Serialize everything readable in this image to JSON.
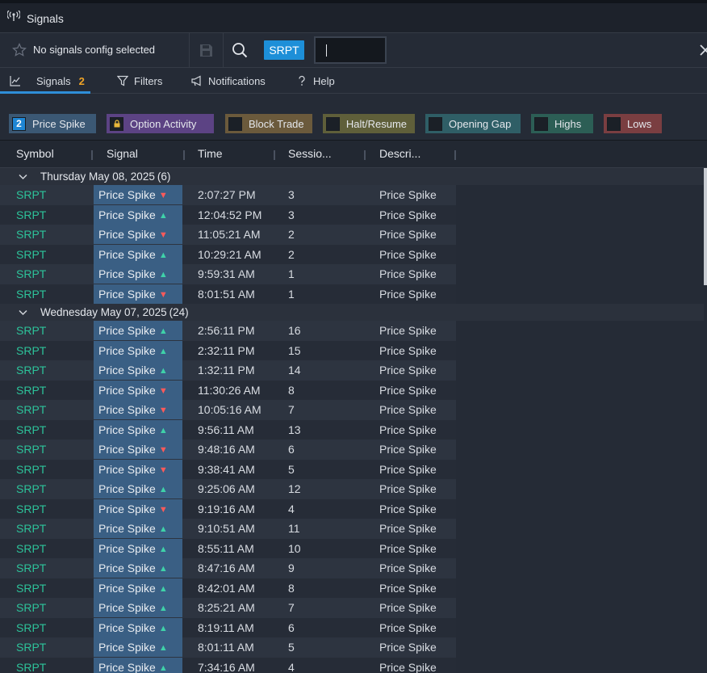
{
  "window": {
    "title": "Signals"
  },
  "toolbar": {
    "config_label": "No signals config selected",
    "symbol": "SRPT",
    "input_value": ""
  },
  "tabs": [
    {
      "label": "Signals",
      "count": "2",
      "icon": "line-chart-icon"
    },
    {
      "label": "Filters",
      "icon": "funnel-icon"
    },
    {
      "label": "Notifications",
      "icon": "megaphone-icon"
    },
    {
      "label": "Help",
      "icon": "question-icon"
    }
  ],
  "chips": [
    {
      "label": "Price Spike",
      "badge": "2",
      "bg": "#3b5874",
      "box": "#1e86d4"
    },
    {
      "label": "Option Activity",
      "badge": "lock",
      "bg": "#5c4384",
      "box": "#1b2027"
    },
    {
      "label": "Block Trade",
      "badge": "",
      "bg": "#6b5a3c",
      "box": "#1b2027"
    },
    {
      "label": "Halt/Resume",
      "badge": "",
      "bg": "#5f5f3a",
      "box": "#1b2027"
    },
    {
      "label": "Opening Gap",
      "badge": "",
      "bg": "#2f5e66",
      "box": "#1b2027"
    },
    {
      "label": "Highs",
      "badge": "",
      "bg": "#2c5e55",
      "box": "#1b2027"
    },
    {
      "label": "Lows",
      "badge": "",
      "bg": "#7a3e41",
      "box": "#1b2027"
    }
  ],
  "columns": [
    "Symbol",
    "Signal",
    "Time",
    "Sessio...",
    "Descri..."
  ],
  "groups": [
    {
      "label": "Thursday May 08, 2025",
      "count": "(6)",
      "rows": [
        {
          "symbol": "SRPT",
          "signal": "Price Spike",
          "dir": "down",
          "time": "2:07:27 PM",
          "session": "3",
          "desc": "Price Spike"
        },
        {
          "symbol": "SRPT",
          "signal": "Price Spike",
          "dir": "up",
          "time": "12:04:52 PM",
          "session": "3",
          "desc": "Price Spike"
        },
        {
          "symbol": "SRPT",
          "signal": "Price Spike",
          "dir": "down",
          "time": "11:05:21 AM",
          "session": "2",
          "desc": "Price Spike"
        },
        {
          "symbol": "SRPT",
          "signal": "Price Spike",
          "dir": "up",
          "time": "10:29:21 AM",
          "session": "2",
          "desc": "Price Spike"
        },
        {
          "symbol": "SRPT",
          "signal": "Price Spike",
          "dir": "up",
          "time": "9:59:31 AM",
          "session": "1",
          "desc": "Price Spike"
        },
        {
          "symbol": "SRPT",
          "signal": "Price Spike",
          "dir": "down",
          "time": "8:01:51 AM",
          "session": "1",
          "desc": "Price Spike"
        }
      ]
    },
    {
      "label": "Wednesday May 07, 2025",
      "count": "(24)",
      "rows": [
        {
          "symbol": "SRPT",
          "signal": "Price Spike",
          "dir": "up",
          "time": "2:56:11 PM",
          "session": "16",
          "desc": "Price Spike"
        },
        {
          "symbol": "SRPT",
          "signal": "Price Spike",
          "dir": "up",
          "time": "2:32:11 PM",
          "session": "15",
          "desc": "Price Spike"
        },
        {
          "symbol": "SRPT",
          "signal": "Price Spike",
          "dir": "up",
          "time": "1:32:11 PM",
          "session": "14",
          "desc": "Price Spike"
        },
        {
          "symbol": "SRPT",
          "signal": "Price Spike",
          "dir": "down",
          "time": "11:30:26 AM",
          "session": "8",
          "desc": "Price Spike"
        },
        {
          "symbol": "SRPT",
          "signal": "Price Spike",
          "dir": "down",
          "time": "10:05:16 AM",
          "session": "7",
          "desc": "Price Spike"
        },
        {
          "symbol": "SRPT",
          "signal": "Price Spike",
          "dir": "up",
          "time": "9:56:11 AM",
          "session": "13",
          "desc": "Price Spike"
        },
        {
          "symbol": "SRPT",
          "signal": "Price Spike",
          "dir": "down",
          "time": "9:48:16 AM",
          "session": "6",
          "desc": "Price Spike"
        },
        {
          "symbol": "SRPT",
          "signal": "Price Spike",
          "dir": "down",
          "time": "9:38:41 AM",
          "session": "5",
          "desc": "Price Spike"
        },
        {
          "symbol": "SRPT",
          "signal": "Price Spike",
          "dir": "up",
          "time": "9:25:06 AM",
          "session": "12",
          "desc": "Price Spike"
        },
        {
          "symbol": "SRPT",
          "signal": "Price Spike",
          "dir": "down",
          "time": "9:19:16 AM",
          "session": "4",
          "desc": "Price Spike"
        },
        {
          "symbol": "SRPT",
          "signal": "Price Spike",
          "dir": "up",
          "time": "9:10:51 AM",
          "session": "11",
          "desc": "Price Spike"
        },
        {
          "symbol": "SRPT",
          "signal": "Price Spike",
          "dir": "up",
          "time": "8:55:11 AM",
          "session": "10",
          "desc": "Price Spike"
        },
        {
          "symbol": "SRPT",
          "signal": "Price Spike",
          "dir": "up",
          "time": "8:47:16 AM",
          "session": "9",
          "desc": "Price Spike"
        },
        {
          "symbol": "SRPT",
          "signal": "Price Spike",
          "dir": "up",
          "time": "8:42:01 AM",
          "session": "8",
          "desc": "Price Spike"
        },
        {
          "symbol": "SRPT",
          "signal": "Price Spike",
          "dir": "up",
          "time": "8:25:21 AM",
          "session": "7",
          "desc": "Price Spike"
        },
        {
          "symbol": "SRPT",
          "signal": "Price Spike",
          "dir": "up",
          "time": "8:19:11 AM",
          "session": "6",
          "desc": "Price Spike"
        },
        {
          "symbol": "SRPT",
          "signal": "Price Spike",
          "dir": "up",
          "time": "8:01:11 AM",
          "session": "5",
          "desc": "Price Spike"
        },
        {
          "symbol": "SRPT",
          "signal": "Price Spike",
          "dir": "up",
          "time": "7:34:16 AM",
          "session": "4",
          "desc": "Price Spike"
        }
      ]
    }
  ],
  "icons": {
    "title": "antenna-icon",
    "star": "star-icon",
    "save": "save-icon",
    "search": "search-icon",
    "close": "close-icon",
    "chevron": "chevron-down-icon",
    "up": "arrow-up-icon",
    "down": "arrow-down-icon"
  }
}
